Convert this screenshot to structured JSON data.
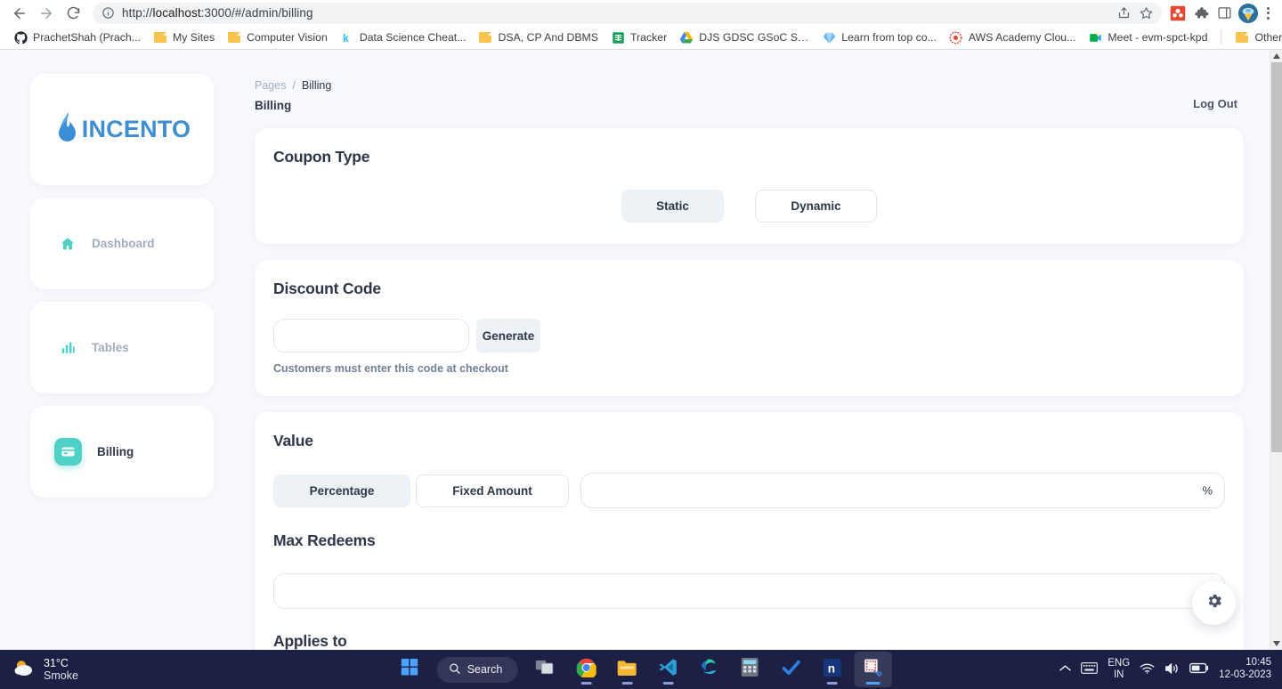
{
  "browser": {
    "url_prefix": "http://",
    "url_host": "localhost",
    "url_rest": ":3000/#/admin/billing",
    "back_icon": "back-arrow-icon",
    "forward_icon": "forward-arrow-icon",
    "reload_icon": "reload-icon",
    "info_icon": "site-info-icon",
    "share_icon": "share-icon",
    "star_icon": "bookmark-star-icon",
    "bookmarks": [
      {
        "label": "PrachetShah (Prach...",
        "icon": "github-icon"
      },
      {
        "label": "My Sites",
        "icon": "folder-icon"
      },
      {
        "label": "Computer Vision",
        "icon": "folder-icon"
      },
      {
        "label": "Data Science Cheat...",
        "icon": "kaggle-icon"
      },
      {
        "label": "DSA, CP And DBMS",
        "icon": "folder-icon"
      },
      {
        "label": "Tracker",
        "icon": "google-sheets-icon"
      },
      {
        "label": "DJS GDSC GSoC Se...",
        "icon": "google-drive-icon"
      },
      {
        "label": "Learn from top co...",
        "icon": "gem-icon"
      },
      {
        "label": "AWS Academy Clou...",
        "icon": "aws-icon"
      },
      {
        "label": "Meet - evm-spct-kpd",
        "icon": "google-meet-icon"
      }
    ],
    "other_bookmarks": "Other bookmarks"
  },
  "sidebar": {
    "brand": "INCENTO",
    "brand_icon": "flame-logo-icon",
    "items": [
      {
        "label": "Dashboard",
        "icon": "home-icon",
        "active": false
      },
      {
        "label": "Tables",
        "icon": "bar-chart-icon",
        "active": false
      },
      {
        "label": "Billing",
        "icon": "credit-card-icon",
        "active": true
      }
    ]
  },
  "header": {
    "breadcrumb_parent": "Pages",
    "breadcrumb_separator": "/",
    "breadcrumb_current": "Billing",
    "page_title": "Billing",
    "logout_label": "Log Out"
  },
  "sections": {
    "coupon_type": {
      "title": "Coupon Type",
      "options": [
        {
          "label": "Static",
          "selected": true
        },
        {
          "label": "Dynamic",
          "selected": false
        }
      ]
    },
    "discount_code": {
      "title": "Discount Code",
      "input_value": "",
      "input_placeholder": "",
      "generate_label": "Generate",
      "helper_text": "Customers must enter this code at checkout"
    },
    "value": {
      "title": "Value",
      "options": [
        {
          "label": "Percentage",
          "selected": true
        },
        {
          "label": "Fixed Amount",
          "selected": false
        }
      ],
      "input_value": "",
      "input_placeholder": "",
      "suffix": "%"
    },
    "max_redeems": {
      "title": "Max Redeems",
      "input_value": "",
      "input_placeholder": ""
    },
    "next_section": {
      "title": "Applies to"
    }
  },
  "fab": {
    "icon": "gear-icon"
  },
  "colors": {
    "accent_teal": "#4fd1c5",
    "brand_blue": "#3f8fd0",
    "page_bg": "#f8f9fe",
    "text_dark": "#2d3748",
    "text_muted": "#a0aec0",
    "selected_bg": "#edf2f7"
  },
  "taskbar": {
    "weather_temp": "31°C",
    "weather_condition": "Smoke",
    "weather_icon": "cloud-sun-icon",
    "search_label": "Search",
    "search_icon": "search-icon",
    "apps": [
      {
        "name": "start-button",
        "icon": "windows-icon"
      },
      {
        "name": "task-view",
        "icon": "task-view-icon"
      },
      {
        "name": "chrome",
        "icon": "chrome-icon"
      },
      {
        "name": "file-explorer",
        "icon": "folder-icon"
      },
      {
        "name": "vs-code",
        "icon": "vscode-icon"
      },
      {
        "name": "edge",
        "icon": "edge-icon"
      },
      {
        "name": "calculator",
        "icon": "calculator-icon"
      },
      {
        "name": "todoist",
        "icon": "checkmark-icon"
      },
      {
        "name": "notion",
        "icon": "notion-icon"
      },
      {
        "name": "snipping-tool",
        "icon": "snipping-tool-icon"
      }
    ],
    "tray": {
      "chevron": "chevron-up-icon",
      "keyboard_icon": "keyboard-icon",
      "language_line1": "ENG",
      "language_line2": "IN",
      "wifi_icon": "wifi-icon",
      "volume_icon": "volume-icon",
      "battery_icon": "battery-icon",
      "time": "10:45",
      "date": "12-03-2023"
    }
  }
}
